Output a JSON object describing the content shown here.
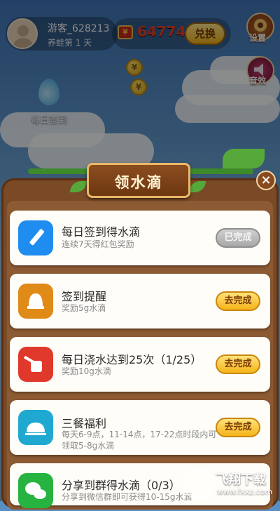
{
  "user": {
    "name": "游客_628213",
    "level": "养蛙第 1 天"
  },
  "currency": {
    "value": "64774",
    "exchange_label": "兑换"
  },
  "side_buttons": {
    "settings": "设置",
    "sound": "音效"
  },
  "daily_checkin_label": "每日签到",
  "dialog": {
    "title": "领水滴",
    "close_label": "×",
    "tasks": [
      {
        "title": "每日签到得水滴",
        "desc": "连续7天得红包奖励",
        "button": "已完成",
        "status": "done",
        "icon": "pencil-icon",
        "color": "#1f8cf0"
      },
      {
        "title": "签到提醒",
        "desc": "奖励5g水滴",
        "button": "去完成",
        "status": "todo",
        "icon": "bell-icon",
        "color": "#e08a17"
      },
      {
        "title": "每日浇水达到25次（1/25）",
        "desc": "奖励10g水滴",
        "button": "去完成",
        "status": "todo",
        "icon": "watering-can-icon",
        "color": "#e0392b"
      },
      {
        "title": "三餐福利",
        "desc": "每天6-9点，11-14点，17-22点时段内可领取5-8g水滴",
        "button": "去完成",
        "status": "todo",
        "icon": "food-cover-icon",
        "color": "#1fa9d1"
      },
      {
        "title": "分享到群得水滴（0/3）",
        "desc": "分享到微信群即可获得10-15g水滴",
        "button": "去完成",
        "status": "todo",
        "icon": "wechat-icon",
        "color": "#26b33f"
      }
    ]
  },
  "watermark": {
    "text": "飞翔下载",
    "url": "www.fxxz.com"
  },
  "colors": {
    "accent": "#f5b41a",
    "panel": "#7a4a26",
    "currency": "#e8402a"
  }
}
